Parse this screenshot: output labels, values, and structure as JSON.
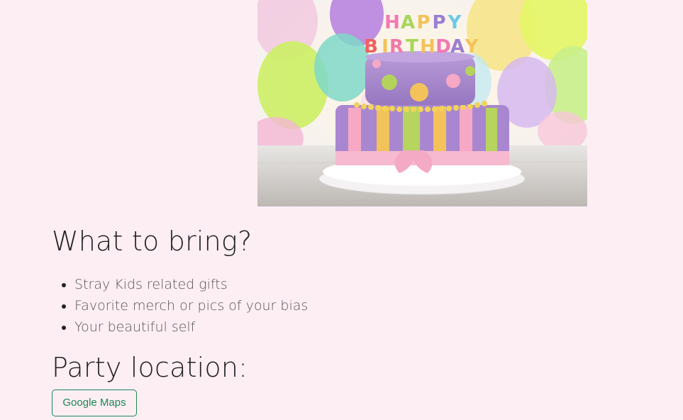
{
  "hero_image": {
    "topper_line1": "HAPPY",
    "topper_line2": "BIRTHDAY"
  },
  "bring_section": {
    "title": "What to bring?",
    "items": [
      "Stray Kids related gifts",
      "Favorite merch or pics of your bias",
      "Your beautiful self"
    ]
  },
  "location_section": {
    "title": "Party location:",
    "button_label": "Google Maps"
  },
  "colors": {
    "page_background": "#fdeef4",
    "heading_text": "#222222",
    "list_text": "#555555",
    "button_accent": "#198754"
  }
}
